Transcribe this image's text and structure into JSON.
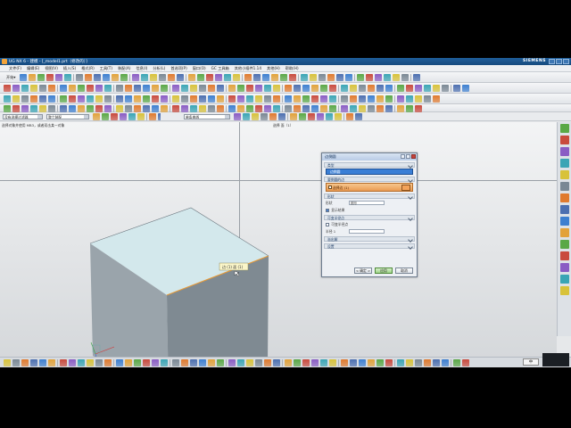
{
  "window": {
    "title": "UG NX 6 - 建模 - [_model1.prt（修改的）]",
    "brand": "SIEMENS"
  },
  "menu": [
    "文件(F)",
    "编辑(E)",
    "视图(V)",
    "插入(S)",
    "格式(R)",
    "工具(T)",
    "装配(A)",
    "信息(I)",
    "分析(L)",
    "首选项(P)",
    "窗口(O)",
    "GC 工具箱",
    "其他小插件1.14",
    "其他(H)",
    "帮助(H)"
  ],
  "toolbar": {
    "start_label": "开始▾",
    "command_finder": "命令查找器"
  },
  "filter": {
    "type_filter": "没有选择过滤器",
    "scope": "整个装配",
    "snap_mode": "单条曲线"
  },
  "viewport": {
    "left_label": "选择对象并使用 MB3，或者双击某一对象",
    "right_label": "选择 面（1）"
  },
  "selection_tooltip": "边 (1) 面 (1)",
  "dialog": {
    "title": "边倒圆",
    "sections": {
      "type": "类型",
      "edge": "要倒圆的边",
      "shape": "形状",
      "variable": "可变半径点",
      "overflow": "溢出解",
      "settings": "设置"
    },
    "type_value": "边倒圆",
    "edge_selected": "选择边 (1)",
    "shape_label": "形状",
    "shape_value": "圆形",
    "radius_label": "半径 1",
    "tangent_label": "可变半径点",
    "preview_label": "显示结果",
    "ok": "< 确定 >",
    "apply": "应用",
    "cancel": "取消"
  },
  "ime": "中",
  "colors": {
    "top_face": "#d3e8ec",
    "left_face": "#9aa4ab",
    "right_face": "#7f8a92",
    "selected_edge": "#e59a3a",
    "accent": "#3a7fd6"
  }
}
